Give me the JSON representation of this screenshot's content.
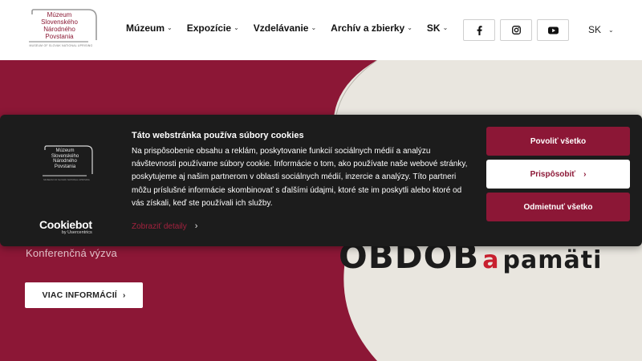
{
  "logo": {
    "lines": [
      "Múzeum",
      "Slovenského",
      "Národného",
      "Povstania"
    ],
    "subtitle": "MUSEUM OF SLOVAK NATIONAL UPRISING"
  },
  "nav": {
    "items": [
      {
        "label": "Múzeum"
      },
      {
        "label": "Expozície"
      },
      {
        "label": "Vzdelávanie"
      },
      {
        "label": "Archív a zbierky"
      },
      {
        "label": "SK"
      }
    ]
  },
  "header_right": {
    "lang": "SK",
    "social": [
      "facebook-icon",
      "instagram-icon",
      "youtube-icon"
    ]
  },
  "hero": {
    "subtitle": "Konferenčná výzva",
    "button_label": "VIAC INFORMÁCIÍ",
    "graphic_text": {
      "main": "OBDOB",
      "conj": "a",
      "word": "pamäti"
    }
  },
  "cookie": {
    "title": "Táto webstránka používa súbory cookies",
    "body": "Na prispôsobenie obsahu a reklám, poskytovanie funkcií sociálnych médií a analýzu návštevnosti používame súbory cookie. Informácie o tom, ako používate naše webové stránky, poskytujeme aj našim partnerom v oblasti sociálnych médií, inzercie a analýzy. Títo partneri môžu príslušné informácie skombinovať s ďalšími údajmi, ktoré ste im poskytli alebo ktoré od vás získali, keď ste používali ich služby.",
    "details_link": "Zobraziť detaily",
    "brand": "Cookiebot",
    "brand_by": "by Usercentrics",
    "allow_all": "Povoliť všetko",
    "customize": "Prispôsobiť",
    "deny_all": "Odmietnuť všetko"
  },
  "colors": {
    "accent": "#8c1736",
    "banner_bg": "#1c1c1c",
    "link": "#a3223e"
  }
}
